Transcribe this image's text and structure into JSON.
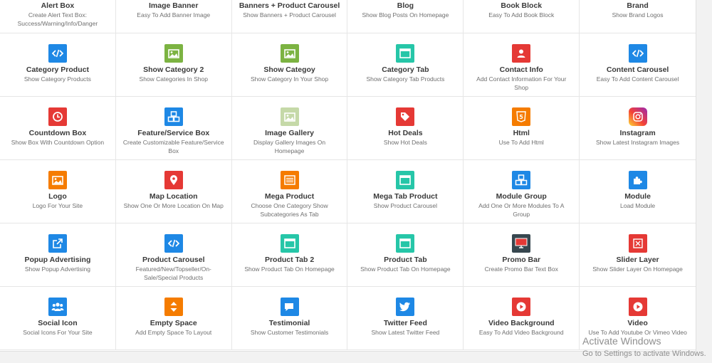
{
  "colors": {
    "blue": "#1e88e5",
    "olive": "#7cb342",
    "teal": "#26c6a8",
    "red": "#e53935",
    "orange": "#f57c00"
  },
  "modules": [
    {
      "title": "Alert Box",
      "desc": "Create Alert Text Box: Success/Warning/Info/Danger",
      "icon": "none"
    },
    {
      "title": "Image Banner",
      "desc": "Easy To Add Banner Image",
      "icon": "none"
    },
    {
      "title": "Banners + Product Carousel",
      "desc": "Show Banners + Product Carousel",
      "icon": "none"
    },
    {
      "title": "Blog",
      "desc": "Show Blog Posts On Homepage",
      "icon": "none"
    },
    {
      "title": "Book Block",
      "desc": "Easy To Add Book Block",
      "icon": "none"
    },
    {
      "title": "Brand",
      "desc": "Show Brand Logos",
      "icon": "none"
    },
    {
      "title": "Category Product",
      "desc": "Show Category Products",
      "icon": "code-icon"
    },
    {
      "title": "Show Category 2",
      "desc": "Show Categories In Shop",
      "icon": "image-icon"
    },
    {
      "title": "Show Categoy",
      "desc": "Show Category In Your Shop",
      "icon": "image-icon"
    },
    {
      "title": "Category Tab",
      "desc": "Show Category Tab Products",
      "icon": "window-icon"
    },
    {
      "title": "Contact Info",
      "desc": "Add Contact Information For Your Shop",
      "icon": "contact-icon"
    },
    {
      "title": "Content Carousel",
      "desc": "Easy To Add Content Carousel",
      "icon": "code-icon"
    },
    {
      "title": "Countdown Box",
      "desc": "Show Box With Countdown Option",
      "icon": "clock-icon"
    },
    {
      "title": "Feature/Service Box",
      "desc": "Create Customizable Feature/Service Box",
      "icon": "cubes-icon"
    },
    {
      "title": "Image Gallery",
      "desc": "Display Gallery Images On Homepage",
      "icon": "image-icon"
    },
    {
      "title": "Hot Deals",
      "desc": "Show Hot Deals",
      "icon": "tag-icon"
    },
    {
      "title": "Html",
      "desc": "Use To Add Html",
      "icon": "html5-icon"
    },
    {
      "title": "Instagram",
      "desc": "Show Latest Instagram Images",
      "icon": "instagram-icon"
    },
    {
      "title": "Logo",
      "desc": "Logo For Your Site",
      "icon": "image-icon"
    },
    {
      "title": "Map Location",
      "desc": "Show One Or More Location On Map",
      "icon": "map-pin-icon"
    },
    {
      "title": "Mega Product",
      "desc": "Choose One Category Show Subcategories As Tab",
      "icon": "list-icon"
    },
    {
      "title": "Mega Tab Product",
      "desc": "Show Product Carousel",
      "icon": "window-icon"
    },
    {
      "title": "Module Group",
      "desc": "Add One Or More Modules To A Group",
      "icon": "cubes-icon"
    },
    {
      "title": "Module",
      "desc": "Load Module",
      "icon": "puzzle-icon"
    },
    {
      "title": "Popup Advertising",
      "desc": "Show Popup Advertising",
      "icon": "external-link-icon"
    },
    {
      "title": "Product Carousel",
      "desc": "Featured/New/Topseller/On-Sale/Special Products",
      "icon": "code-icon"
    },
    {
      "title": "Product Tab 2",
      "desc": "Show Product Tab On Homepage",
      "icon": "window-icon"
    },
    {
      "title": "Product Tab",
      "desc": "Show Product Tab On Homepage",
      "icon": "window-icon"
    },
    {
      "title": "Promo Bar",
      "desc": "Create Promo Bar Text Box",
      "icon": "monitor-icon"
    },
    {
      "title": "Slider Layer",
      "desc": "Show Slider Layer On Homepage",
      "icon": "slider-icon"
    },
    {
      "title": "Social Icon",
      "desc": "Social Icons For Your Site",
      "icon": "users-icon"
    },
    {
      "title": "Empty Space",
      "desc": "Add Empty Space To Layout",
      "icon": "arrows-vertical-icon"
    },
    {
      "title": "Testimonial",
      "desc": "Show Customer Testimonials",
      "icon": "comments-icon"
    },
    {
      "title": "Twitter Feed",
      "desc": "Show Latest Twitter Feed",
      "icon": "twitter-icon"
    },
    {
      "title": "Video Background",
      "desc": "Easy To Add Video Background",
      "icon": "play-icon"
    },
    {
      "title": "Video",
      "desc": "Use To Add Youtube Or Vimeo Video",
      "icon": "play-icon"
    }
  ],
  "watermark": {
    "line1": "Activate Windows",
    "line2": "Go to Settings to activate Windows."
  }
}
